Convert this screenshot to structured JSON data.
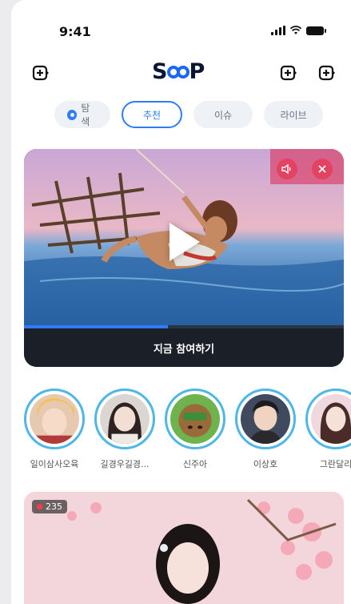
{
  "status_bar": {
    "time": "9:41"
  },
  "header": {
    "logo_left": "S",
    "logo_right": "P",
    "left_icon": "plus-square-icon",
    "right_icons": [
      "plus-square-icon",
      "plus-square-icon"
    ]
  },
  "tabs": [
    {
      "label": "탐색",
      "active": false,
      "icon": "compass-icon"
    },
    {
      "label": "추천",
      "active": true
    },
    {
      "label": "이슈",
      "active": false
    },
    {
      "label": "라이브",
      "active": false
    }
  ],
  "hero": {
    "cta_label": "지금 참여하기",
    "progress": 0.45,
    "controls": [
      "volume-icon",
      "close-icon"
    ]
  },
  "streamers": [
    {
      "name": "일이삼사오육"
    },
    {
      "name": "길경우길경..."
    },
    {
      "name": "신주아"
    },
    {
      "name": "이상호"
    },
    {
      "name": "그란달리"
    }
  ],
  "live_card": {
    "viewers": "235"
  },
  "colors": {
    "accent": "#2f7cf6",
    "ring": "#4fb6e8",
    "logo": "#0a1633"
  }
}
